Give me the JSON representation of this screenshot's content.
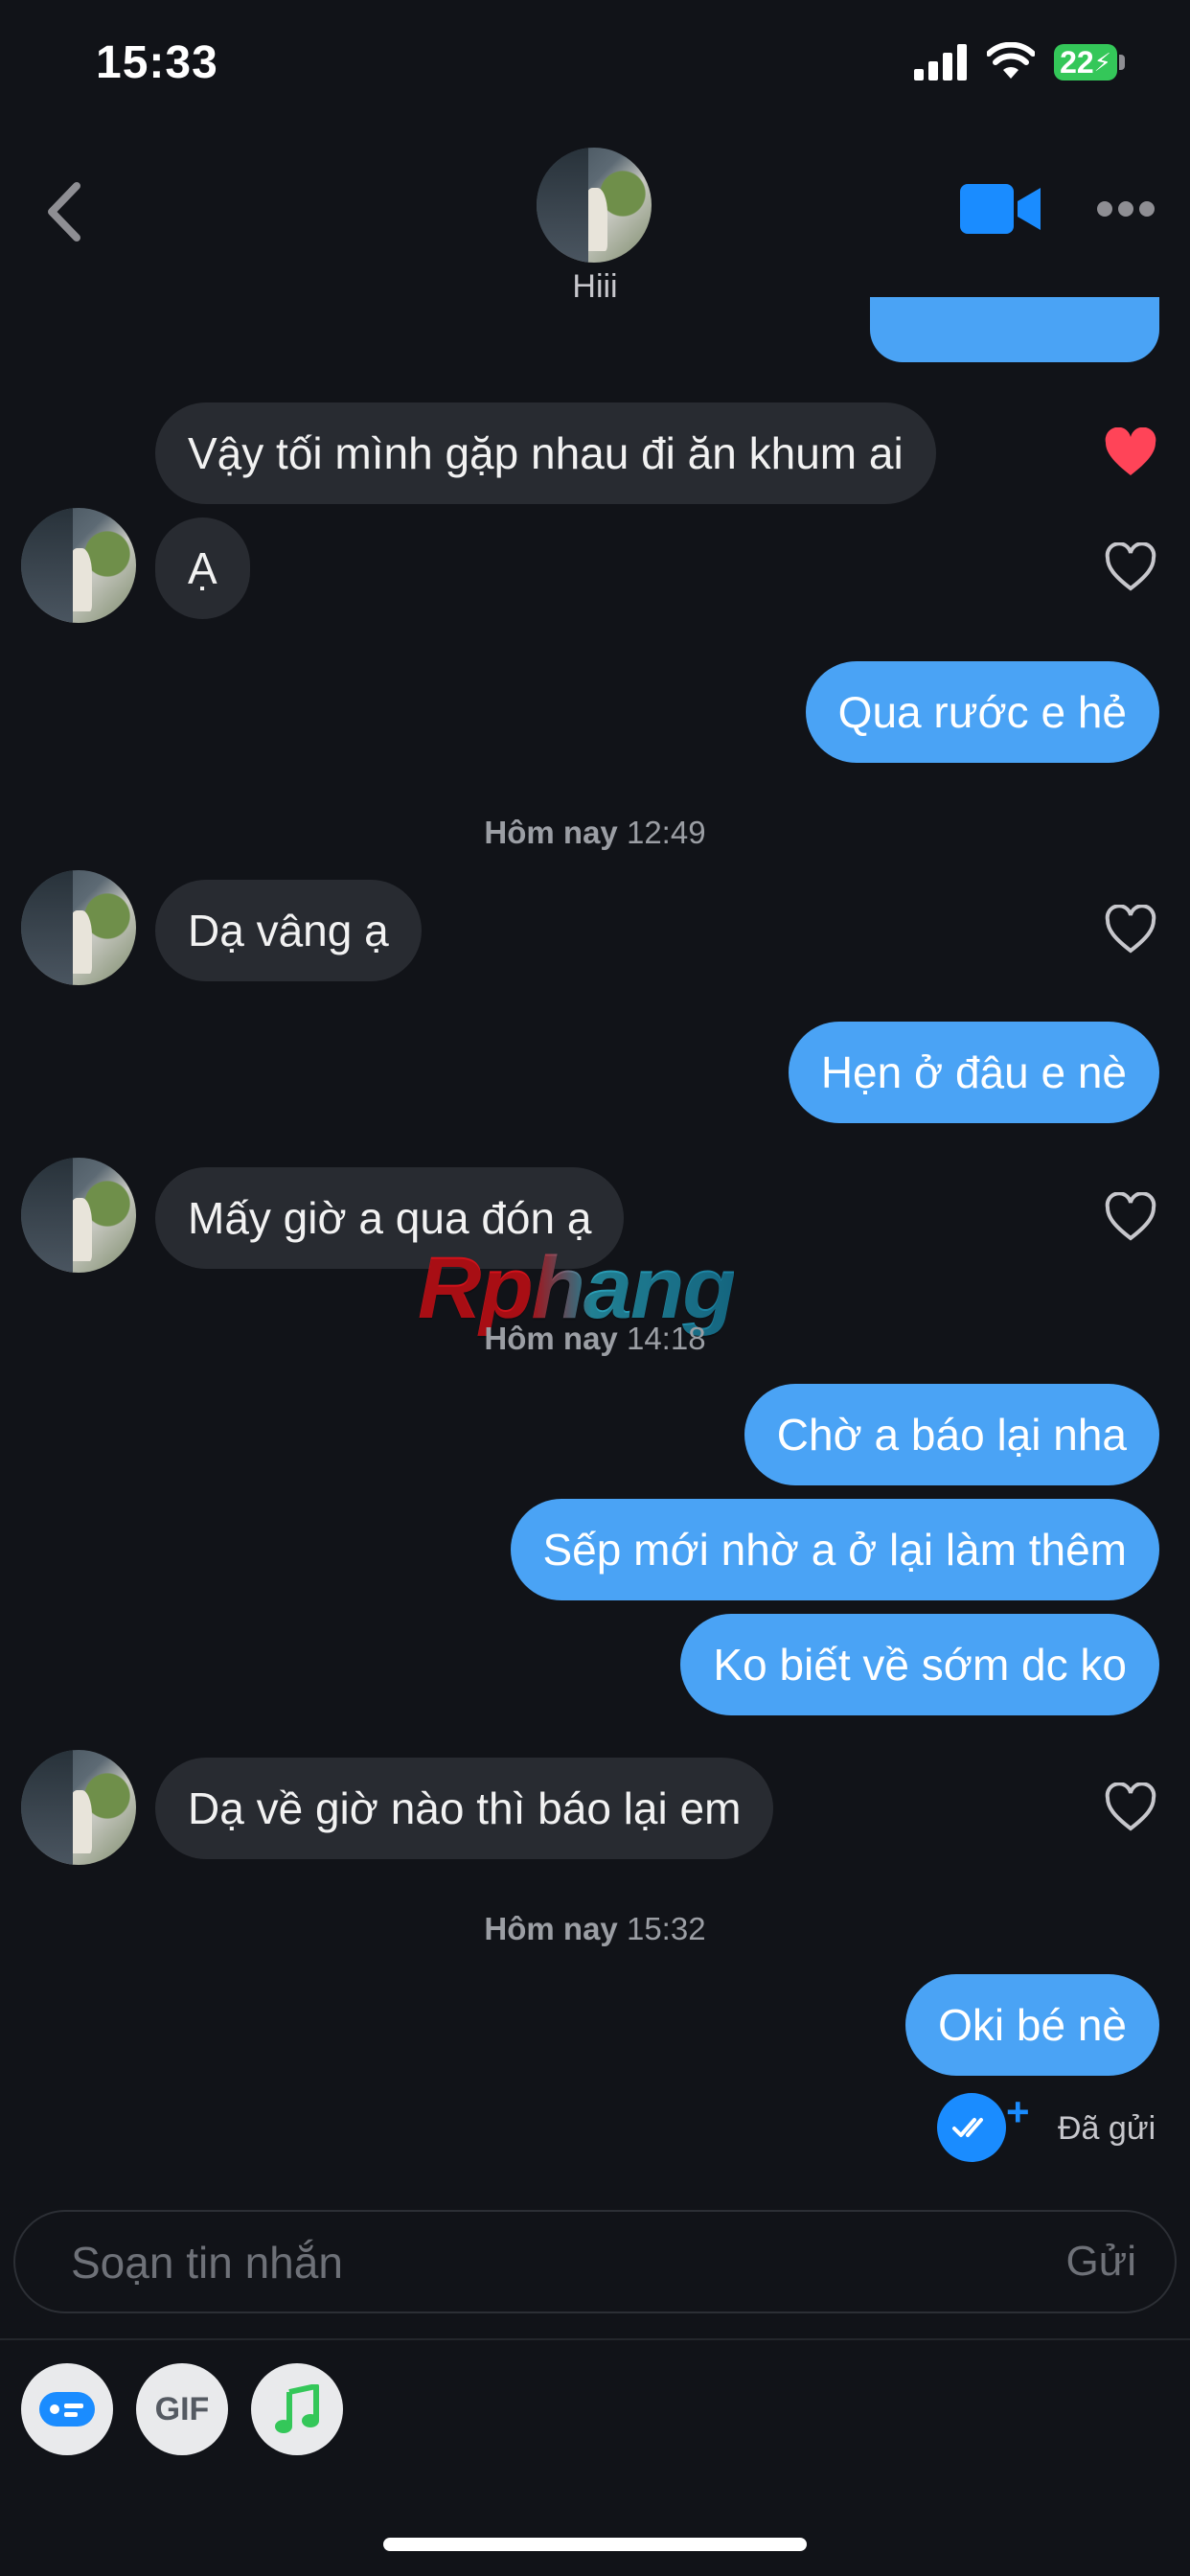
{
  "status_bar": {
    "time": "15:33",
    "battery": "22"
  },
  "header": {
    "contact_name": "Hiii"
  },
  "messages": [
    {
      "text": "Vậy tối mình gặp nhau đi ăn khum ai",
      "liked": true
    },
    {
      "text": "Ạ",
      "liked": false
    },
    {
      "text": "Qua rước e hẻ"
    },
    {
      "text": "Dạ vâng ạ",
      "liked": false
    },
    {
      "text": "Hẹn ở đâu e nè"
    },
    {
      "text": "Mấy giờ a qua đón ạ",
      "liked": false
    },
    {
      "text": "Chờ a báo lại nha"
    },
    {
      "text": "Sếp mới nhờ a ở lại làm thêm"
    },
    {
      "text": "Ko biết về sớm dc ko"
    },
    {
      "text": "Dạ về giờ nào thì báo lại em",
      "liked": false
    },
    {
      "text": "Oki bé nè"
    }
  ],
  "timestamps": [
    {
      "day": "Hôm nay",
      "time": "12:49"
    },
    {
      "day": "Hôm nay",
      "time": "14:18"
    },
    {
      "day": "Hôm nay",
      "time": "15:32"
    }
  ],
  "delivery_status": "Đã gửi",
  "composer": {
    "placeholder": "Soạn tin nhắn",
    "send_label": "Gửi"
  },
  "toolbar": {
    "gif_label": "GIF"
  },
  "watermark": "Rphang",
  "colors": {
    "background": "#111318",
    "outgoing_bubble": "#4aa3f5",
    "incoming_bubble": "#282b31",
    "accent": "#1a8cff",
    "heart_liked": "#ff4458"
  }
}
